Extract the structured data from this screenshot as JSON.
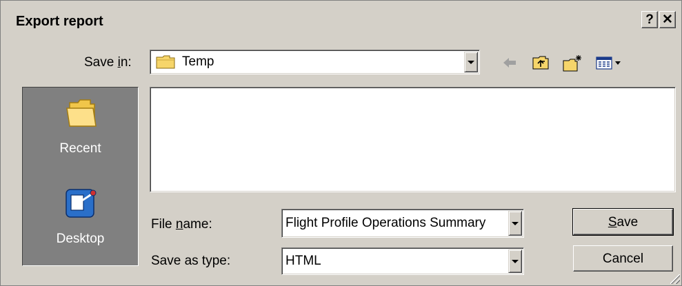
{
  "window": {
    "title": "Export report",
    "help_label": "?",
    "close_label": "✕"
  },
  "save_in": {
    "label_pre": "Save ",
    "label_key": "i",
    "label_post": "n:",
    "value": "Temp"
  },
  "toolbar": {
    "icons": [
      "back-arrow-icon",
      "up-folder-icon",
      "new-folder-icon",
      "view-menu-icon"
    ]
  },
  "places": [
    {
      "label": "Recent",
      "icon": "folder-icon"
    },
    {
      "label": "Desktop",
      "icon": "desktop-icon"
    }
  ],
  "file_name": {
    "label_pre": "File ",
    "label_key": "n",
    "label_post": "ame:",
    "value": "Flight Profile Operations Summary"
  },
  "save_as_type": {
    "label": "Save as type:",
    "value": "HTML"
  },
  "buttons": {
    "save_key": "S",
    "save_rest": "ave",
    "cancel": "Cancel"
  },
  "colors": {
    "dialog_bg": "#d4d0c8",
    "places_bg": "#808080",
    "folder_yellow": "#f6d56a",
    "desktop_blue": "#2a6fc9"
  }
}
